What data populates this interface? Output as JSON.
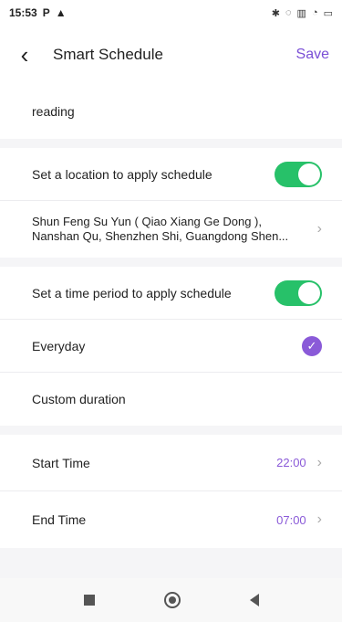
{
  "status_bar": {
    "time": "15:53",
    "left_icons": [
      "P",
      "⚠"
    ],
    "right_icons": [
      "bluetooth-icon",
      "no-disturb-icon",
      "signal-icon",
      "wifi-icon",
      "battery-icon"
    ]
  },
  "header": {
    "title": "Smart Schedule",
    "save_label": "Save"
  },
  "schedule": {
    "name": "reading"
  },
  "location": {
    "label": "Set a location to apply schedule",
    "enabled": true,
    "address_line1": "Shun Feng Su Yun ( Qiao Xiang Ge Dong ),",
    "address_line2": "Nanshan Qu, Shenzhen Shi, Guangdong Shen..."
  },
  "time_period": {
    "label": "Set a time period to apply schedule",
    "enabled": true,
    "options": [
      {
        "label": "Everyday",
        "selected": true
      },
      {
        "label": "Custom duration",
        "selected": false
      }
    ]
  },
  "times": {
    "start_label": "Start Time",
    "start_value": "22:00",
    "end_label": "End Time",
    "end_value": "07:00"
  },
  "colors": {
    "accent": "#7a4fd6",
    "toggle_on": "#27c169"
  }
}
